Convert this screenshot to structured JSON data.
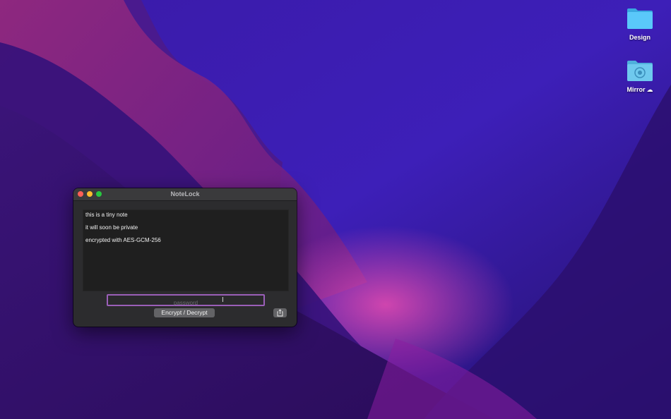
{
  "desktop": {
    "icons": [
      {
        "label": "Design",
        "icon": "folder-icon",
        "color": "#5ac8fa"
      },
      {
        "label": "Mirror",
        "icon": "shared-folder-icon",
        "color": "#6fc9ee",
        "badge": "icloud-icon"
      }
    ]
  },
  "window": {
    "title": "NoteLock",
    "note_lines": [
      "this is a tiny note",
      "it will soon be private",
      "encrypted with AES-GCM-256"
    ],
    "password_placeholder": "password",
    "encrypt_button": "Encrypt / Decrypt",
    "share_icon": "share-icon"
  },
  "colors": {
    "focus_ring": "#9b5fb8",
    "close": "#fe5f57",
    "minimize": "#febc2e",
    "maximize": "#28c840"
  }
}
